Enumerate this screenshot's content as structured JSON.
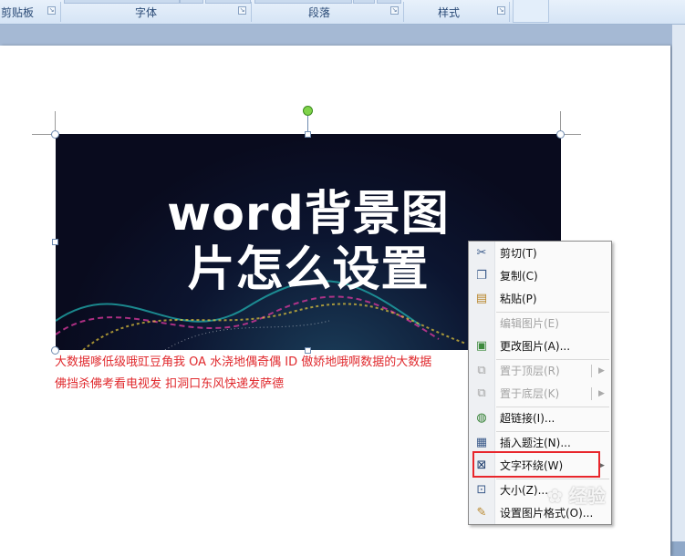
{
  "ribbon": {
    "groups": [
      "剪贴板",
      "字体",
      "段落",
      "样式"
    ]
  },
  "picture": {
    "title_line1": "word背景图",
    "title_line2": "片怎么设置"
  },
  "document": {
    "line1": "大数据嗲低级哦豇豆角我 OA 水浇地偶奇偶 ID 傲娇地哦啊数据的大数据",
    "line2": "佛挡杀佛考看电视发 扣洞口东风快递发萨德"
  },
  "context_menu": {
    "items": [
      {
        "label": "剪切(T)",
        "icon": "scissors-icon",
        "enabled": true
      },
      {
        "label": "复制(C)",
        "icon": "copy-icon",
        "enabled": true
      },
      {
        "label": "粘贴(P)",
        "icon": "paste-icon",
        "enabled": true
      },
      {
        "label": "编辑图片(E)",
        "icon": "",
        "enabled": false
      },
      {
        "label": "更改图片(A)...",
        "icon": "change-picture-icon",
        "enabled": true
      },
      {
        "label": "置于顶层(R)",
        "icon": "bring-to-front-icon",
        "enabled": false,
        "submenu": true
      },
      {
        "label": "置于底层(K)",
        "icon": "send-to-back-icon",
        "enabled": false,
        "submenu": true
      },
      {
        "label": "超链接(I)...",
        "icon": "hyperlink-icon",
        "enabled": true
      },
      {
        "label": "插入题注(N)...",
        "icon": "caption-icon",
        "enabled": true
      },
      {
        "label": "文字环绕(W)",
        "icon": "text-wrap-icon",
        "enabled": true,
        "submenu": true
      },
      {
        "label": "大小(Z)...",
        "icon": "size-icon",
        "enabled": true
      },
      {
        "label": "设置图片格式(O)...",
        "icon": "format-picture-icon",
        "enabled": true
      }
    ]
  },
  "watermark": {
    "text": "经验"
  },
  "colors": {
    "highlight": "#e8262c",
    "body_text": "#e0292d"
  }
}
